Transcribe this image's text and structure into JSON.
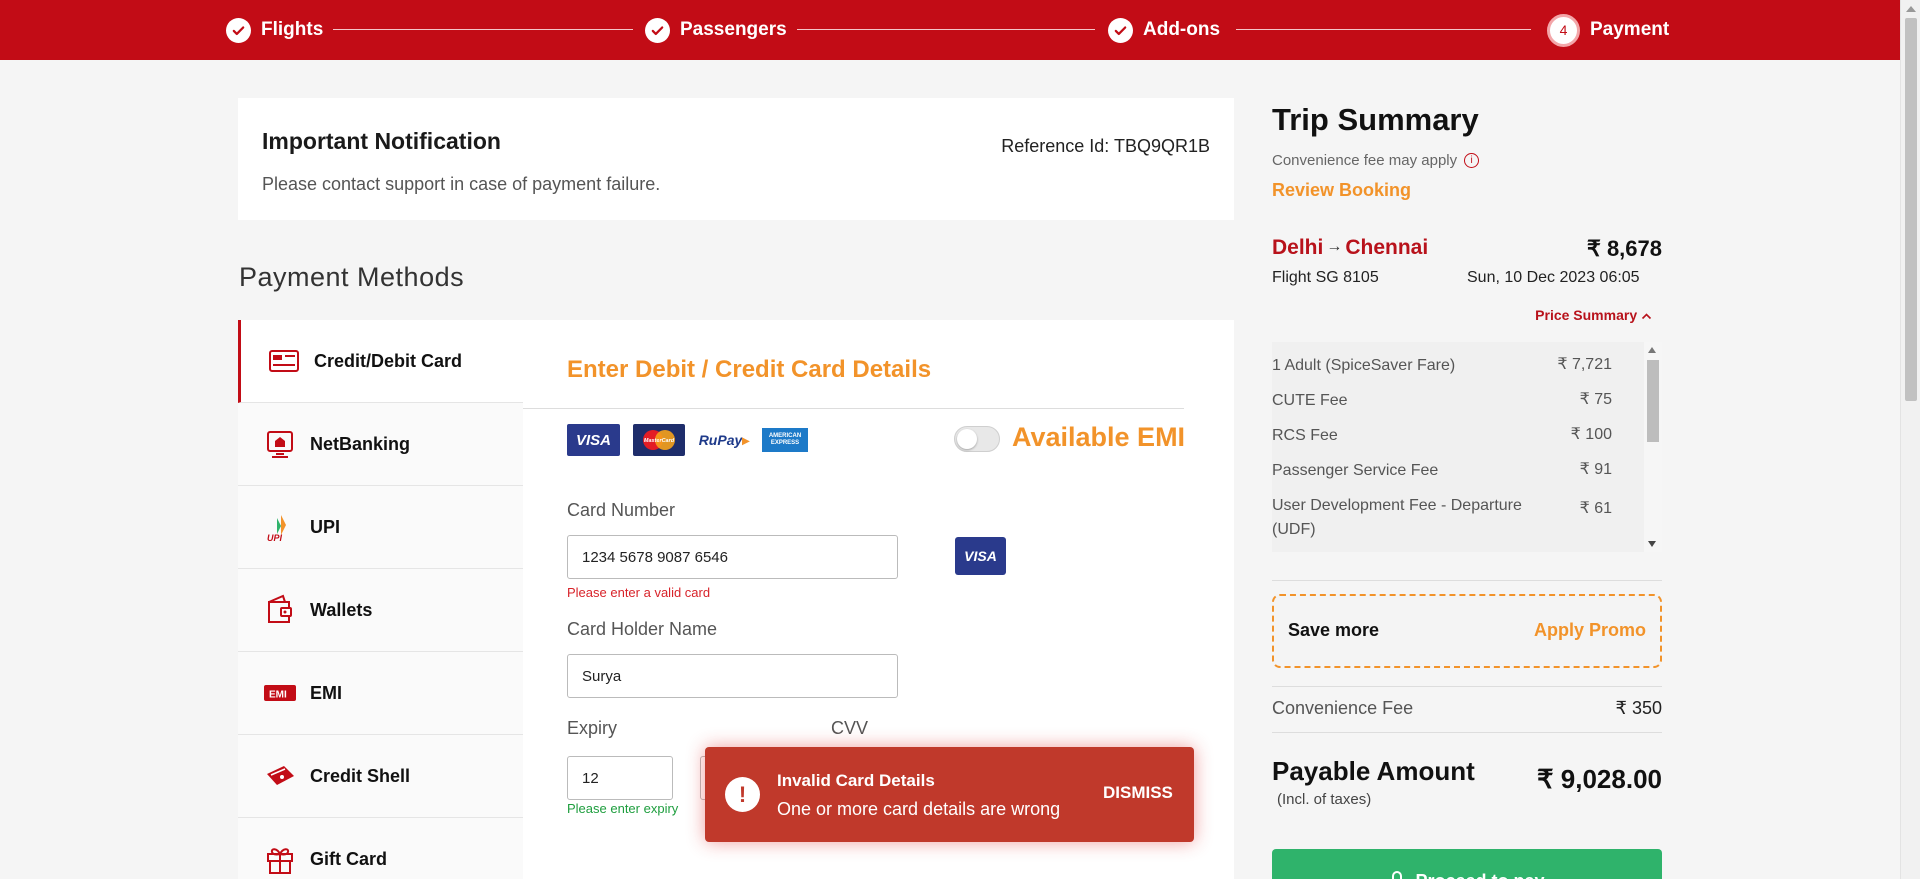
{
  "steps": [
    {
      "label": "Flights",
      "state": "done"
    },
    {
      "label": "Passengers",
      "state": "done"
    },
    {
      "label": "Add-ons",
      "state": "done"
    },
    {
      "label": "Payment",
      "state": "current",
      "number": "4"
    }
  ],
  "colors": {
    "brand_red": "#c20c16",
    "accent_orange": "#f2932a",
    "success_green": "#2fb36b",
    "toast_red": "#c0392b"
  },
  "notification": {
    "title": "Important Notification",
    "message": "Please contact support in case of payment failure.",
    "reference": "Reference Id: TBQ9QR1B"
  },
  "payment_methods": {
    "title": "Payment Methods",
    "items": [
      {
        "label": "Credit/Debit Card",
        "icon": "credit-card-icon",
        "active": true
      },
      {
        "label": "NetBanking",
        "icon": "bank-icon"
      },
      {
        "label": "UPI",
        "icon": "upi-icon"
      },
      {
        "label": "Wallets",
        "icon": "wallet-icon"
      },
      {
        "label": "EMI",
        "icon": "emi-icon"
      },
      {
        "label": "Credit Shell",
        "icon": "credit-shell-icon"
      },
      {
        "label": "Gift Card",
        "icon": "gift-icon"
      }
    ]
  },
  "card_form": {
    "heading": "Enter Debit / Credit Card Details",
    "brands": [
      "VISA",
      "MasterCard",
      "RuPay",
      "AMERICAN EXPRESS"
    ],
    "emi_label": "Available EMI",
    "emi_enabled": false,
    "card_number_label": "Card Number",
    "card_number_value": "1234 5678 9087 6546",
    "card_number_error": "Please enter a valid card",
    "detected_brand": "VISA",
    "holder_label": "Card Holder Name",
    "holder_value": "Surya",
    "expiry_label": "Expiry",
    "expiry_value": "12",
    "expiry_hint": "Please enter expiry",
    "cvv_label": "CVV"
  },
  "toast": {
    "icon": "!",
    "title": "Invalid Card Details",
    "message": "One or more card details are wrong",
    "dismiss": "DISMISS"
  },
  "summary": {
    "title": "Trip Summary",
    "note": "Convenience fee may apply",
    "review": "Review Booking",
    "from": "Delhi",
    "to": "Chennai",
    "arrow": "→",
    "total": "₹ 8,678",
    "flight": "Flight  SG 8105",
    "date": "Sun, 10 Dec 2023  06:05",
    "price_toggle": "Price Summary",
    "breakdown": [
      {
        "label": "1 Adult  (SpiceSaver Fare)",
        "value": "₹ 7,721"
      },
      {
        "label": "CUTE Fee",
        "value": "₹ 75"
      },
      {
        "label": "RCS Fee",
        "value": "₹ 100"
      },
      {
        "label": "Passenger Service Fee",
        "value": "₹ 91"
      },
      {
        "label": "User Development Fee - Departure (UDF)",
        "value": "₹ 61"
      }
    ],
    "promo_label": "Save more",
    "promo_action": "Apply Promo",
    "convenience_label": "Convenience Fee",
    "convenience_value": "₹ 350",
    "payable_label": "Payable Amount",
    "payable_sub": "(Incl. of taxes)",
    "payable_value": "₹ 9,028.00",
    "proceed": "Proceed to pay"
  }
}
